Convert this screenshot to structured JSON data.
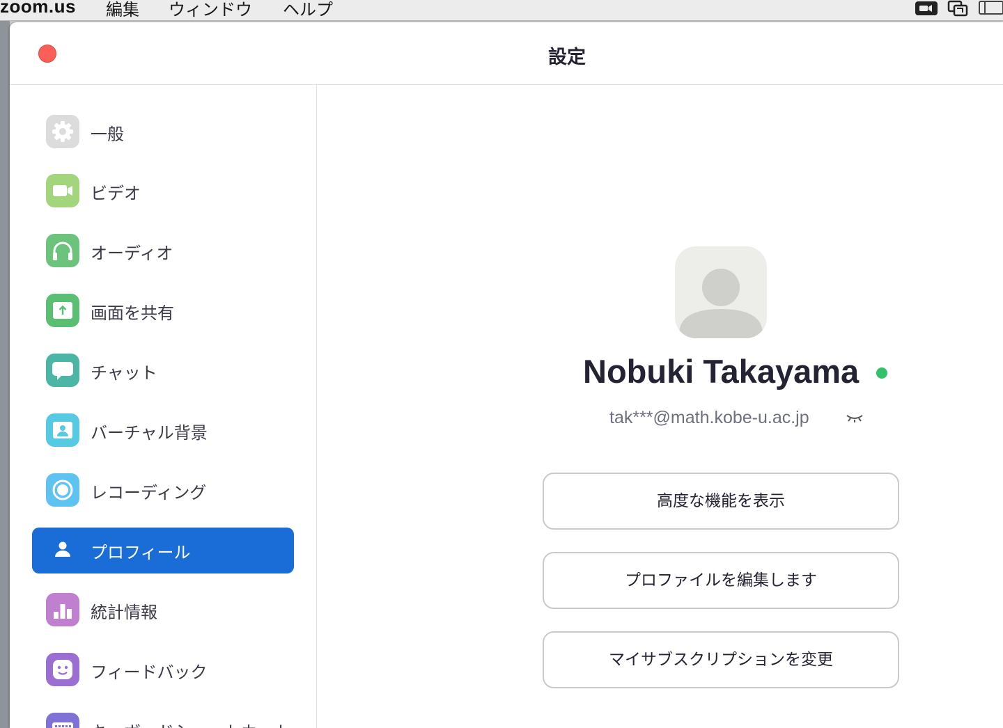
{
  "menubar": {
    "app_name": "zoom.us",
    "items": [
      "編集",
      "ウィンドウ",
      "ヘルプ"
    ]
  },
  "window": {
    "title": "設定"
  },
  "sidebar": {
    "items": [
      {
        "label": "一般",
        "icon": "gear-icon",
        "color": "#d9d9d9"
      },
      {
        "label": "ビデオ",
        "icon": "video-camera-icon",
        "color": "#a3d57c"
      },
      {
        "label": "オーディオ",
        "icon": "headphones-icon",
        "color": "#6cc37c"
      },
      {
        "label": "画面を共有",
        "icon": "share-screen-icon",
        "color": "#5abf73"
      },
      {
        "label": "チャット",
        "icon": "chat-bubble-icon",
        "color": "#4bb5a6"
      },
      {
        "label": "バーチャル背景",
        "icon": "virtual-background-icon",
        "color": "#56c9e3"
      },
      {
        "label": "レコーディング",
        "icon": "record-icon",
        "color": "#5fc3f0"
      },
      {
        "label": "プロフィール",
        "icon": "person-icon",
        "color": "#1a6cd6"
      },
      {
        "label": "統計情報",
        "icon": "bar-chart-icon",
        "color": "#c17fd0"
      },
      {
        "label": "フィードバック",
        "icon": "smiley-icon",
        "color": "#9a6fd1"
      },
      {
        "label": "キーボードショートカット",
        "icon": "keyboard-icon",
        "color": "#7f71d6"
      }
    ],
    "active_index": 7
  },
  "profile": {
    "name": "Nobuki Takayama",
    "email": "tak***@math.kobe-u.ac.jp",
    "status_color": "#32c26a",
    "buttons": {
      "advanced": "高度な機能を表示",
      "edit_profile": "プロファイルを編集します",
      "change_subscription": "マイサブスクリプションを変更"
    }
  }
}
